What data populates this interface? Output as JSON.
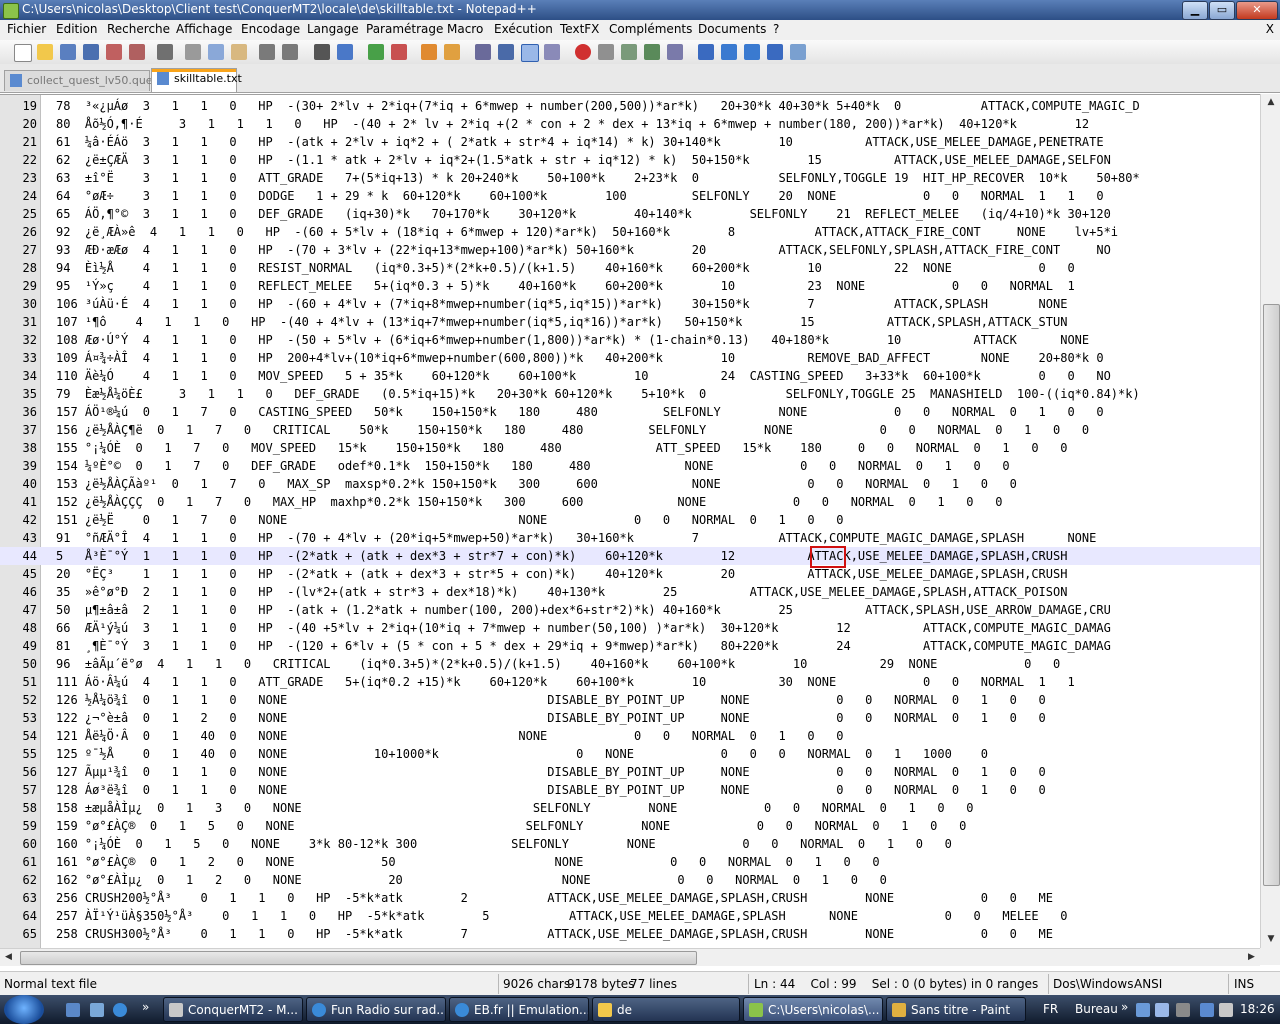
{
  "window": {
    "title": "C:\\Users\\nicolas\\Desktop\\Client test\\ConquerMT2\\locale\\de\\skilltable.txt - Notepad++"
  },
  "menu": [
    "Fichier",
    "Edition",
    "Recherche",
    "Affichage",
    "Encodage",
    "Langage",
    "Paramétrage",
    "Macro",
    "Exécution",
    "TextFX",
    "Compléments",
    "Documents",
    "?"
  ],
  "menu_close": "X",
  "tabs": [
    {
      "label": "collect_quest_lv50.quest",
      "active": false
    },
    {
      "label": "skilltable.txt",
      "active": true
    }
  ],
  "lines": [
    {
      "n": "19",
      "t": "78  ³«¿µÁø  3   1   1   0   HP  -(30+ 2*lv + 2*iq+(7*iq + 6*mwep + number(200,500))*ar*k)   20+30*k 40+30*k 5+40*k  0           ATTACK,COMPUTE_MAGIC_D"
    },
    {
      "n": "20",
      "t": "80  Åõ½Ó,¶·É     3   1   1   1   0   HP  -(40 + 2* lv + 2*iq +(2 * con + 2 * dex + 13*iq + 6*mwep + number(180, 200))*ar*k)  40+120*k        12"
    },
    {
      "n": "21",
      "t": "61  ¼â·ÉÁö  3   1   1   0   HP  -(atk + 2*lv + iq*2 + ( 2*atk + str*4 + iq*14) * k) 30+140*k        10          ATTACK,USE_MELEE_DAMAGE,PENETRATE"
    },
    {
      "n": "22",
      "t": "62  ¿ë±ÇÆÄ  3   1   1   0   HP  -(1.1 * atk + 2*lv + iq*2+(1.5*atk + str + iq*12) * k)  50+150*k        15          ATTACK,USE_MELEE_DAMAGE,SELFON"
    },
    {
      "n": "23",
      "t": "63  ±î°Ë    3   1   1   0   ATT_GRADE   7+(5*iq+13) * k 20+240*k    50+100*k    2+23*k  0           SELFONLY,TOGGLE 19  HIT_HP_RECOVER  10*k    50+80*"
    },
    {
      "n": "24",
      "t": "64  °øÆ÷    3   1   1   0   DODGE   1 + 29 * k  60+120*k    60+100*k        100         SELFONLY    20  NONE            0   0   NORMAL  1   1   0"
    },
    {
      "n": "25",
      "t": "65  ÁÖ,¶°©  3   1   1   0   DEF_GRADE   (iq+30)*k   70+170*k    30+120*k        40+140*k        SELFONLY    21  REFLECT_MELEE   (iq/4+10)*k 30+120"
    },
    {
      "n": "26",
      "t": "92  ¿ë¸ÆÀ»ê  4   1   1   0   HP  -(60 + 5*lv + (18*iq + 6*mwep + 120)*ar*k)  50+160*k        8           ATTACK,ATTACK_FIRE_CONT     NONE    lv+5*i"
    },
    {
      "n": "27",
      "t": "93  ÆÐ·æÆø  4   1   1   0   HP  -(70 + 3*lv + (22*iq+13*mwep+100)*ar*k) 50+160*k        20          ATTACK,SELFONLY,SPLASH,ATTACK_FIRE_CONT     NO"
    },
    {
      "n": "28",
      "t": "94  Èì½Å    4   1   1   0   RESIST_NORMAL   (iq*0.3+5)*(2*k+0.5)/(k+1.5)    40+160*k    60+200*k        10          22  NONE            0   0"
    },
    {
      "n": "29",
      "t": "95  ¹Ý»ç    4   1   1   0   REFLECT_MELEE   5+(iq*0.3 + 5)*k    40+160*k    60+200*k        10          23  NONE            0   0   NORMAL  1"
    },
    {
      "n": "30",
      "t": "106 ³úÀü·É  4   1   1   0   HP  -(60 + 4*lv + (7*iq+8*mwep+number(iq*5,iq*15))*ar*k)    30+150*k        7           ATTACK,SPLASH       NONE"
    },
    {
      "n": "31",
      "t": "107 ¹­¶ô    4   1   1   0   HP  -(40 + 4*lv + (13*iq+7*mwep+number(iq*5,iq*16))*ar*k)   50+150*k        15          ATTACK,SPLASH,ATTACK_STUN"
    },
    {
      "n": "32",
      "t": "108 Æø·Ú°Ý  4   1   1   0   HP  -(50 + 5*lv + (6*iq+6*mwep+number(1,800))*ar*k) * (1-chain*0.13)   40+180*k        10          ATTACK      NONE"
    },
    {
      "n": "33",
      "t": "109 Á¤¾÷ÀÎ  4   1   1   0   HP  200+4*lv+(10*iq+6*mwep+number(600,800))*k   40+200*k        10          REMOVE_BAD_AFFECT       NONE    20+80*k 0"
    },
    {
      "n": "34",
      "t": "110 Äè¼Ó    4   1   1   0   MOV_SPEED   5 + 35*k    60+120*k    60+100*k        10          24  CASTING_SPEED   3+33*k  60+100*k        0   0   NO"
    },
    {
      "n": "35",
      "t": "79  Èæ½Å¼öÈ£     3   1   1   0   DEF_GRADE   (0.5*iq+15)*k   20+30*k 60+120*k    5+10*k  0           SELFONLY,TOGGLE 25  MANASHIELD  100-((iq*0.84)*k)"
    },
    {
      "n": "36",
      "t": "157 ÁÖ¹®¼ú  0   1   7   0   CASTING_SPEED   50*k    150+150*k   180     480         SELFONLY        NONE            0   0   NORMAL  0   1   0   0"
    },
    {
      "n": "37",
      "t": "156 ¿ë½ÅÀÇ¶ë  0   1   7   0   CRITICAL    50*k    150+150*k   180     480         SELFONLY        NONE            0   0   NORMAL  0   1   0   0"
    },
    {
      "n": "38",
      "t": "155 °¡¼ÓÈ­  0   1   7   0   MOV_SPEED   15*k    150+150*k   180     480             ATT_SPEED   15*k    180     0   0   NORMAL  0   1   0   0"
    },
    {
      "n": "39",
      "t": "154 ¼ºÈ°©  0   1   7   0   DEF_GRADE   odef*0.1*k  150+150*k   180     480             NONE            0   0   NORMAL  0   1   0   0"
    },
    {
      "n": "40",
      "t": "153 ¿ë½ÅÀÇÃàº¹  0   1   7   0   MAX_SP  maxsp*0.2*k 150+150*k   300     600             NONE            0   0   NORMAL  0   1   0   0"
    },
    {
      "n": "41",
      "t": "152 ¿ë½ÅÀÇÇÇ  0   1   7   0   MAX_HP  maxhp*0.2*k 150+150*k   300     600             NONE            0   0   NORMAL  0   1   0   0"
    },
    {
      "n": "42",
      "t": "151 ¿ë½Ë    0   1   7   0   NONE                                NONE            0   0   NORMAL  0   1   0   0"
    },
    {
      "n": "43",
      "t": "91  °ñÆÄ°Î  4   1   1   0   HP  -(70 + 4*lv + (20*iq+5*mwep+50)*ar*k)   30+160*k        7           ATTACK,COMPUTE_MAGIC_DAMAGE,SPLASH      NONE"
    },
    {
      "n": "44",
      "t": "5   Å³È¯°Ý  1   1   1   0   HP  -(2*atk + (atk + dex*3 + str*7 + con)*k)    60+120*k        12          ATTACK,USE_MELEE_DAMAGE,SPLASH,CRUSH"
    },
    {
      "n": "45",
      "t": "20  °ËÇ³    1   1   1   0   HP  -(2*atk + (atk + dex*3 + str*5 + con)*k)    40+120*k        20          ATTACK,USE_MELEE_DAMAGE,SPLASH,CRUSH"
    },
    {
      "n": "46",
      "t": "35  »ê°ø°Ð  2   1   1   0   HP  -(lv*2+(atk + str*3 + dex*18)*k)    40+130*k        25          ATTACK,USE_MELEE_DAMAGE,SPLASH,ATTACK_POISON"
    },
    {
      "n": "47",
      "t": "50  µ¶±â±â  2   1   1   0   HP  -(atk + (1.2*atk + number(100, 200)+dex*6+str*2)*k) 40+160*k        25          ATTACK,SPLASH,USE_ARROW_DAMAGE,CRU"
    },
    {
      "n": "48",
      "t": "66  ÆÄ¹ý¼ú  3   1   1   0   HP  -(40 +5*lv + 2*iq+(10*iq + 7*mwep + number(50,100) )*ar*k)  30+120*k        12          ATTACK,COMPUTE_MAGIC_DAMAG"
    },
    {
      "n": "49",
      "t": "81  ¸¶È¯°Ý  3   1   1   0   HP  -(120 + 6*lv + (5 * con + 5 * dex + 29*iq + 9*mwep)*ar*k)   80+220*k        24          ATTACK,COMPUTE_MAGIC_DAMAG"
    },
    {
      "n": "50",
      "t": "96  ±âÃµ´ë°ø  4   1   1   0   CRITICAL    (iq*0.3+5)*(2*k+0.5)/(k+1.5)    40+160*k    60+100*k        10          29  NONE            0   0"
    },
    {
      "n": "51",
      "t": "111 Áö·Â¼ú  4   1   1   0   ATT_GRADE   5+(iq*0.2 +15)*k    60+120*k    60+100*k        10          30  NONE            0   0   NORMAL  1   1"
    },
    {
      "n": "52",
      "t": "126 ½Å¼ö¾î  0   1   1   0   NONE                                    DISABLE_BY_POINT_UP     NONE            0   0   NORMAL  0   1   0   0"
    },
    {
      "n": "53",
      "t": "122 ¿¬°è±â  0   1   2   0   NONE                                    DISABLE_BY_POINT_UP     NONE            0   0   NORMAL  0   1   0   0"
    },
    {
      "n": "54",
      "t": "121 Åë¼Ö·Â  0   1   40  0   NONE                                NONE            0   0   NORMAL  0   1   0   0"
    },
    {
      "n": "55",
      "t": "125 º¯½Å    0   1   40  0   NONE            10+1000*k                   0   NONE            0   0   0   NORMAL  0   1   1000    0"
    },
    {
      "n": "56",
      "t": "127 Ãµµ¹¾î  0   1   1   0   NONE                                    DISABLE_BY_POINT_UP     NONE            0   0   NORMAL  0   1   0   0"
    },
    {
      "n": "57",
      "t": "128 Áø³ë¾î  0   1   1   0   NONE                                    DISABLE_BY_POINT_UP     NONE            0   0   NORMAL  0   1   0   0"
    },
    {
      "n": "58",
      "t": "158 ±æµåÀÌµ¿  0   1   3   0   NONE                                SELFONLY        NONE            0   0   NORMAL  0   1   0   0"
    },
    {
      "n": "59",
      "t": "159 °ø°£ÀÇ®  0   1   5   0   NONE                                SELFONLY        NONE            0   0   NORMAL  0   1   0   0"
    },
    {
      "n": "60",
      "t": "160 °¡¼ÓÈ­  0   1   5   0   NONE    3*k 80-12*k 300             SELFONLY        NONE            0   0   NORMAL  0   1   0   0"
    },
    {
      "n": "61",
      "t": "161 °ø°£ÀÇ®  0   1   2   0   NONE            50                      NONE            0   0   NORMAL  0   1   0   0"
    },
    {
      "n": "62",
      "t": "162 °ø°£ÀÌµ¿  0   1   2   0   NONE            20                      NONE            0   0   NORMAL  0   1   0   0"
    },
    {
      "n": "63",
      "t": "256 CRUSH200½°Å³    0   1   1   0   HP  -5*k*atk        2           ATTACK,USE_MELEE_DAMAGE,SPLASH,CRUSH        NONE            0   0   ME"
    },
    {
      "n": "64",
      "t": "257 ÀÏ¹Ý¹üÀ§350½°Å³    0   1   1   0   HP  -5*k*atk        5           ATTACK,USE_MELEE_DAMAGE,SPLASH      NONE            0   0   MELEE   0"
    },
    {
      "n": "65",
      "t": "258 CRUSH300½°Å³    0   1   1   0   HP  -5*k*atk        7           ATTACK,USE_MELEE_DAMAGE,SPLASH,CRUSH        NONE            0   0   ME"
    }
  ],
  "current_line": "44",
  "highlight_value": "12",
  "status": {
    "type": "Normal text file",
    "chars": "9026 chars",
    "bytes": "9178 bytes",
    "lines": "77 lines",
    "position": "Ln : 44    Col : 99    Sel : 0 (0 bytes) in 0 ranges",
    "eol": "Dos\\Windows",
    "encoding": "ANSI",
    "mode": "INS"
  },
  "taskbar": {
    "buttons": [
      {
        "label": "ConquerMT2 - M...",
        "active": false
      },
      {
        "label": "Fun Radio sur rad...",
        "active": false
      },
      {
        "label": "EB.fr || Emulation...",
        "active": false
      },
      {
        "label": "de",
        "active": false
      },
      {
        "label": "C:\\Users\\nicolas\\...",
        "active": true
      },
      {
        "label": "Sans titre - Paint",
        "active": false
      }
    ],
    "lang": "FR",
    "desktop": "Bureau",
    "chevron": "»",
    "clock": "18:26"
  }
}
